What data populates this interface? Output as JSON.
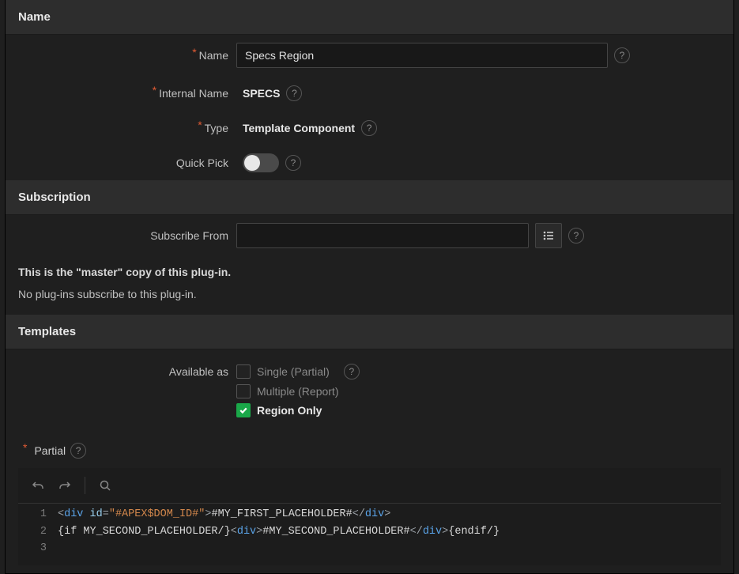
{
  "sections": {
    "name_header": "Name",
    "subscription_header": "Subscription",
    "templates_header": "Templates"
  },
  "name": {
    "name_label": "Name",
    "name_value": "Specs Region",
    "internal_name_label": "Internal Name",
    "internal_name_value": "SPECS",
    "type_label": "Type",
    "type_value": "Template Component",
    "quick_pick_label": "Quick Pick",
    "quick_pick_value": false
  },
  "subscription": {
    "subscribe_from_label": "Subscribe From",
    "subscribe_from_value": "",
    "master_text": "This is the \"master\" copy of this plug-in.",
    "no_subscribers_text": "No plug-ins subscribe to this plug-in."
  },
  "templates": {
    "available_as_label": "Available as",
    "options": {
      "single": {
        "label": "Single (Partial)",
        "checked": false
      },
      "multiple": {
        "label": "Multiple (Report)",
        "checked": false
      },
      "region": {
        "label": "Region Only",
        "checked": true
      }
    },
    "partial_label": "Partial",
    "code": {
      "line1": {
        "raw": "<div id=\"#APEX$DOM_ID#\">#MY_FIRST_PLACEHOLDER#</div>",
        "div": "div",
        "id_attr": "id",
        "id_val": "\"#APEX$DOM_ID#\"",
        "body": "#MY_FIRST_PLACEHOLDER#"
      },
      "line2": {
        "raw": "{if MY_SECOND_PLACEHOLDER/}<div>#MY_SECOND_PLACEHOLDER#</div>{endif/}",
        "if_open": "{if MY_SECOND_PLACEHOLDER/}",
        "div": "div",
        "body": "#MY_SECOND_PLACEHOLDER#",
        "endif": "{endif/}"
      }
    }
  }
}
